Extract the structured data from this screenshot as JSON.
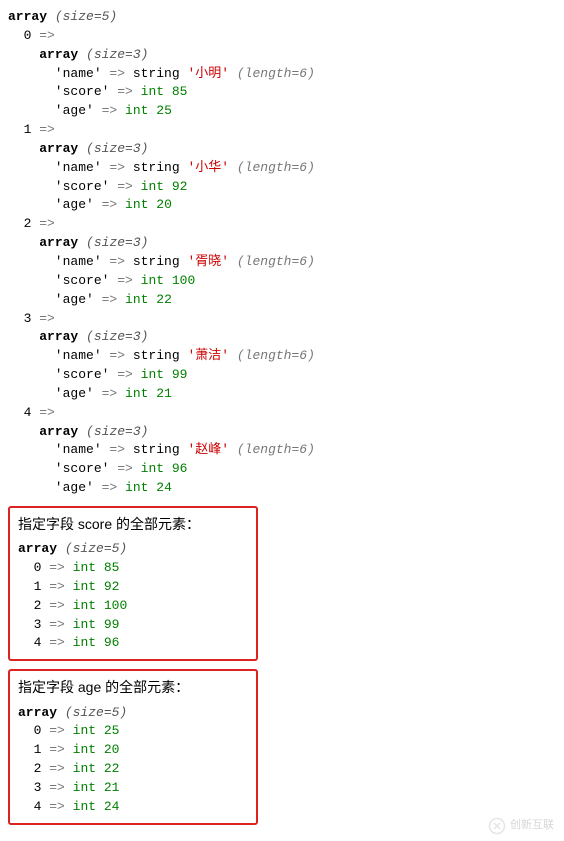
{
  "dump": {
    "type": "array",
    "size": 5,
    "items": [
      {
        "index": 0,
        "type": "array",
        "size": 3,
        "name": "小明",
        "name_len": 6,
        "score": 85,
        "age": 25
      },
      {
        "index": 1,
        "type": "array",
        "size": 3,
        "name": "小华",
        "name_len": 6,
        "score": 92,
        "age": 20
      },
      {
        "index": 2,
        "type": "array",
        "size": 3,
        "name": "胥晓",
        "name_len": 6,
        "score": 100,
        "age": 22
      },
      {
        "index": 3,
        "type": "array",
        "size": 3,
        "name": "萧洁",
        "name_len": 6,
        "score": 99,
        "age": 21
      },
      {
        "index": 4,
        "type": "array",
        "size": 3,
        "name": "赵峰",
        "name_len": 6,
        "score": 96,
        "age": 24
      }
    ],
    "keys": {
      "name": "name",
      "score": "score",
      "age": "age"
    },
    "string_kw": "string",
    "int_kw": "int",
    "length_kw": "length"
  },
  "box1": {
    "label": "指定字段 score 的全部元素：",
    "type": "array",
    "size": 5,
    "values": [
      85,
      92,
      100,
      99,
      96
    ]
  },
  "box2": {
    "label": "指定字段 age 的全部元素：",
    "type": "array",
    "size": 5,
    "values": [
      25,
      20,
      22,
      21,
      24
    ]
  },
  "watermark": "创新互联"
}
